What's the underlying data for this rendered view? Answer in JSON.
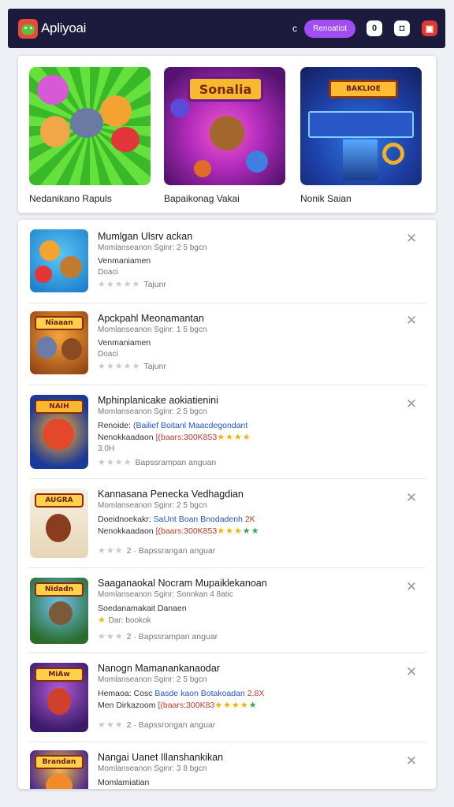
{
  "header": {
    "app_title": "Apliyoai",
    "dot": "c",
    "pill_label": "Renoatiot",
    "btn1": "0",
    "btn2": "◘",
    "btn3": "▣"
  },
  "featured": [
    {
      "caption": "Nedanikano Rapuls",
      "icon": "animal-friends-art"
    },
    {
      "caption": "Bapaikonag Vakai",
      "icon": "sonalia-hero-art",
      "art_title": "Sonalia"
    },
    {
      "caption": "Nonik Saian",
      "icon": "neon-arcade-art",
      "art_title": "BAKLIOE"
    }
  ],
  "list": [
    {
      "name": "Mumlgan Ulsrv ackan",
      "sub": "Momlanseanon Sginr: 2 5 bgcn",
      "line1": "Venmaniamen",
      "line2": "Doaci",
      "rating": "Tajunr",
      "stars_gold": 0,
      "icon": "game-thumb-1"
    },
    {
      "name": "Apckpahl Meonamantan",
      "sub": "Momlanseanon Sginr: 1 5 bgcn",
      "line1": "Venmaniamen",
      "line2": "Doaci",
      "rating": "Tajunr",
      "stars_gold": 0,
      "icon": "game-thumb-2",
      "thumb_label": "Niaaan"
    },
    {
      "name": "Mphinplanicake aokiatienini",
      "sub": "Momlanseanon Sginr: 2 5 bgcn",
      "line1_a": "Renoide:",
      "line1_b": "(Bailief Boitanl Maacdegondant",
      "line2_a": "Nenokkaadaon",
      "line2_b": "[(baars:300K853",
      "line3": "3.0H",
      "rating": "Bapssrampan anguan",
      "stars_gold": 0,
      "icon": "game-thumb-3",
      "thumb_label": "NAIH"
    },
    {
      "name": "Kannasana Penecka Vedhagdian",
      "sub": "Momlanseanon Sginr: 2 5 bgcn",
      "line1_a": "Doeidnoekakr:",
      "line1_b": "SaUnt Boan Bnodadenh",
      "line1_c": "2K",
      "line2_a": "Nenokkaadaon",
      "line2_b": "[(baars:300K853",
      "rating": "2 · Bapssrangan anguar",
      "stars_gold": 0,
      "icon": "game-thumb-4",
      "thumb_label": "AUGRA"
    },
    {
      "name": "Saaganaokal Nocram Mupaiklekanoan",
      "sub": "Momlanseanon Sginr: Sonnkan 4 8atic",
      "line1": "Soedanamakait Danaen",
      "line2": "Dar: bookok",
      "rating": "2 · Bapssrampan anguar",
      "stars_gold": 0,
      "icon": "game-thumb-5",
      "thumb_label": "Nidadn"
    },
    {
      "name": "Nanogn Mamanankanaodar",
      "sub": "Momlanseanon Sginr: 2 5 bgcn",
      "line1_a": "Hemaoa: Cosc",
      "line1_b": "Basde kaon Botakoadan",
      "line1_c": "2.8X",
      "line2_a": "Men Dirkazoom",
      "line2_b": "[(baars:300K83",
      "rating": "2 · Bapssrongan anguar",
      "stars_gold": 0,
      "icon": "game-thumb-6",
      "thumb_label": "MiAw"
    },
    {
      "name": "Nangai Uanet Illanshankikan",
      "sub": "Momlanseanon Sginr: 3 8 bgcn",
      "line1": "Momlamiatian",
      "icon": "game-thumb-7",
      "thumb_label": "Brandan"
    }
  ],
  "colors": {
    "header_bg": "#1d1b3d",
    "accent_purple": "#a04ef2",
    "accent_red": "#e0392f",
    "star_gold": "#f4b400"
  }
}
